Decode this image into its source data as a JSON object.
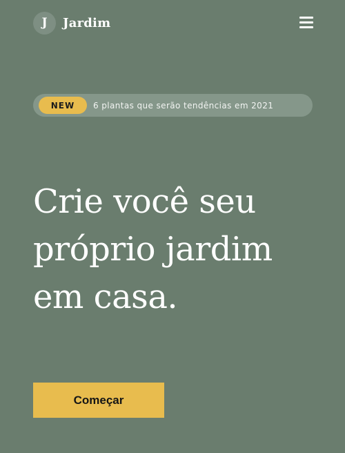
{
  "header": {
    "logo_letter": "J",
    "brand_name": "Jardim",
    "menu_icon": "hamburger-menu-icon"
  },
  "announcement": {
    "badge": "NEW",
    "text": "6 plantas que serão tendências em 2021"
  },
  "hero": {
    "title_line1": "Crie você seu",
    "title_line2": "próprio jardim",
    "title_line3": "em casa.",
    "cta_label": "Começar"
  },
  "colors": {
    "background": "#6a7d6e",
    "accent": "#e8bc4e",
    "pill_background": "#85978a",
    "logo_circle": "#7e8f83",
    "text": "#ffffff"
  }
}
